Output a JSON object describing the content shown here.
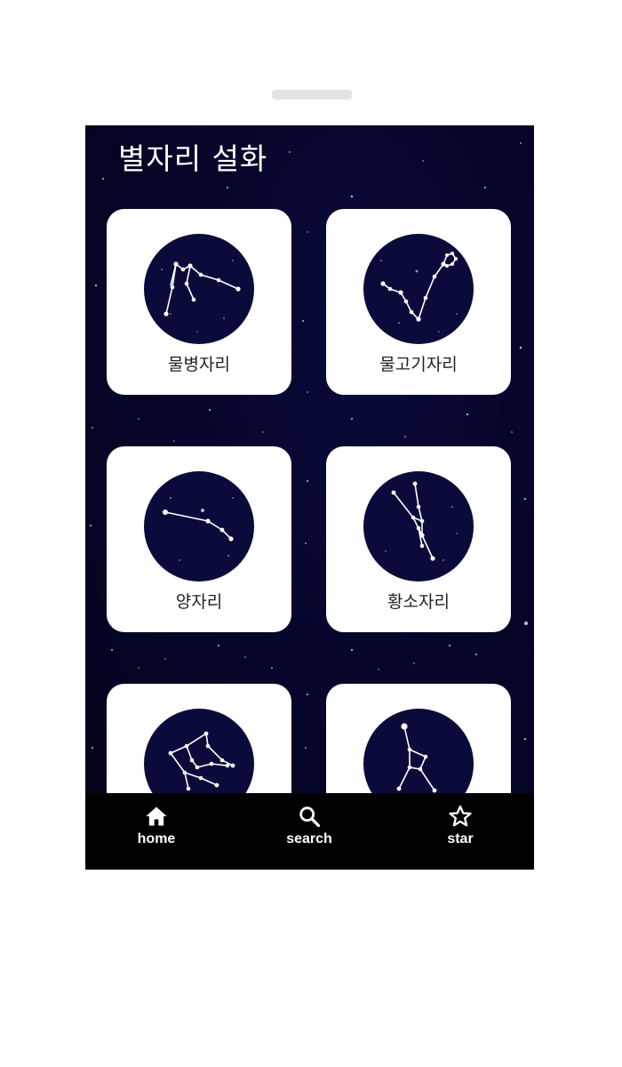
{
  "app": {
    "title": "별자리 설화"
  },
  "constellations": [
    {
      "name": "물병자리",
      "icon": "aquarius-constellation-icon"
    },
    {
      "name": "물고기자리",
      "icon": "pisces-constellation-icon"
    },
    {
      "name": "양자리",
      "icon": "aries-constellation-icon"
    },
    {
      "name": "황소자리",
      "icon": "taurus-constellation-icon"
    },
    {
      "name": "",
      "icon": "gemini-constellation-icon"
    },
    {
      "name": "",
      "icon": "cancer-constellation-icon"
    }
  ],
  "nav": {
    "items": [
      {
        "label": "home",
        "icon": "home-icon"
      },
      {
        "label": "search",
        "icon": "search-icon"
      },
      {
        "label": "star",
        "icon": "star-icon"
      }
    ]
  },
  "colors": {
    "background": "#050528",
    "card": "#ffffff",
    "emblem": "#0b0b3b",
    "nav_bar": "#000000",
    "text_light": "#ffffff"
  }
}
